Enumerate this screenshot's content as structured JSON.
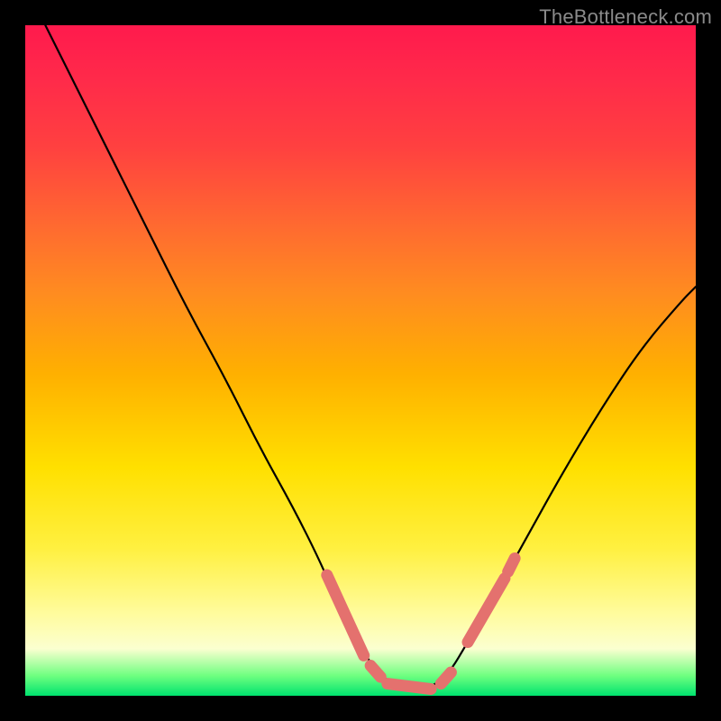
{
  "watermark": "TheBottleneck.com",
  "chart_data": {
    "type": "line",
    "title": "",
    "xlabel": "",
    "ylabel": "",
    "xlim": [
      0,
      100
    ],
    "ylim": [
      0,
      100
    ],
    "grid": false,
    "curve": {
      "name": "bottleneck-curve",
      "color": "#000000",
      "points": [
        {
          "x": 3.0,
          "y": 100.0
        },
        {
          "x": 7.0,
          "y": 92.0
        },
        {
          "x": 12.0,
          "y": 82.0
        },
        {
          "x": 18.0,
          "y": 70.0
        },
        {
          "x": 24.0,
          "y": 58.0
        },
        {
          "x": 30.0,
          "y": 47.0
        },
        {
          "x": 35.0,
          "y": 37.0
        },
        {
          "x": 40.0,
          "y": 28.0
        },
        {
          "x": 44.0,
          "y": 20.0
        },
        {
          "x": 47.0,
          "y": 13.0
        },
        {
          "x": 50.0,
          "y": 7.0
        },
        {
          "x": 53.0,
          "y": 3.0
        },
        {
          "x": 56.0,
          "y": 1.0
        },
        {
          "x": 60.0,
          "y": 1.0
        },
        {
          "x": 63.0,
          "y": 3.0
        },
        {
          "x": 66.0,
          "y": 8.0
        },
        {
          "x": 70.0,
          "y": 15.0
        },
        {
          "x": 75.0,
          "y": 24.0
        },
        {
          "x": 80.0,
          "y": 33.0
        },
        {
          "x": 86.0,
          "y": 43.0
        },
        {
          "x": 92.0,
          "y": 52.0
        },
        {
          "x": 98.0,
          "y": 59.0
        },
        {
          "x": 100.0,
          "y": 61.0
        }
      ]
    },
    "highlight": {
      "name": "highlight-segments",
      "color": "#e4716e",
      "segments": [
        [
          {
            "x": 45.0,
            "y": 18.0
          },
          {
            "x": 50.5,
            "y": 6.0
          }
        ],
        [
          {
            "x": 51.5,
            "y": 4.5
          },
          {
            "x": 53.0,
            "y": 2.8
          }
        ],
        [
          {
            "x": 54.0,
            "y": 1.8
          },
          {
            "x": 60.5,
            "y": 1.0
          }
        ],
        [
          {
            "x": 62.0,
            "y": 1.8
          },
          {
            "x": 63.5,
            "y": 3.5
          }
        ],
        [
          {
            "x": 66.0,
            "y": 8.0
          },
          {
            "x": 71.5,
            "y": 17.5
          }
        ],
        [
          {
            "x": 72.0,
            "y": 18.5
          },
          {
            "x": 73.0,
            "y": 20.5
          }
        ]
      ]
    }
  }
}
